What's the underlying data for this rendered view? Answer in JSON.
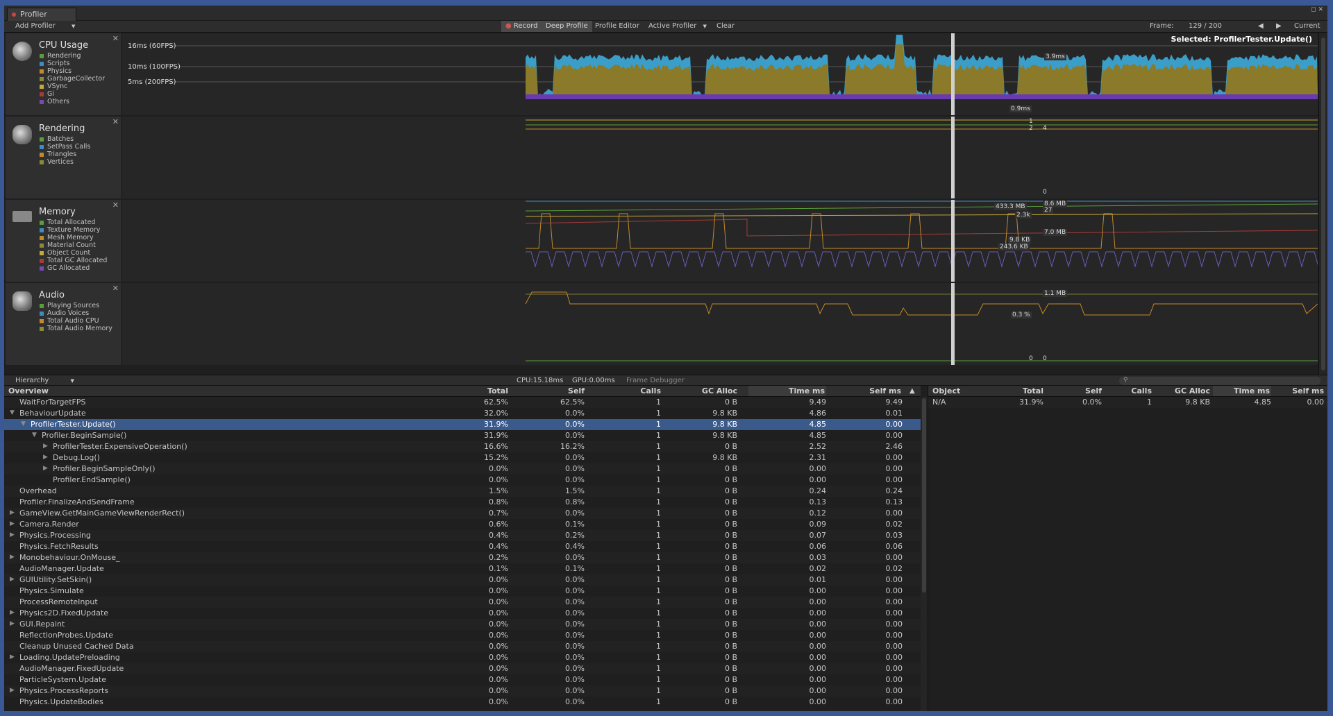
{
  "window": {
    "tab_title": "Profiler"
  },
  "toolbar": {
    "add_profiler": "Add Profiler",
    "record": "Record",
    "deep_profile": "Deep Profile",
    "profile_editor": "Profile Editor",
    "active_profiler": "Active Profiler",
    "clear": "Clear",
    "frame_label": "Frame:",
    "frame_value": "129 / 200",
    "current": "Current"
  },
  "cpu": {
    "title": "CPU Usage",
    "items": [
      {
        "label": "Rendering",
        "color": "#5a9e3a"
      },
      {
        "label": "Scripts",
        "color": "#3a8ec4"
      },
      {
        "label": "Physics",
        "color": "#c48a2a"
      },
      {
        "label": "GarbageCollector",
        "color": "#8a8a3a"
      },
      {
        "label": "VSync",
        "color": "#c4a83a"
      },
      {
        "label": "Gi",
        "color": "#a83a3a"
      },
      {
        "label": "Others",
        "color": "#7a4ab4"
      }
    ],
    "lines": [
      "16ms (60FPS)",
      "10ms (100FPS)",
      "5ms (200FPS)"
    ],
    "selected": "Selected: ProfilerTester.Update()",
    "val1": "3.9ms",
    "val2": "0.9ms"
  },
  "rendering": {
    "title": "Rendering",
    "items": [
      {
        "label": "Batches",
        "color": "#5a9e3a"
      },
      {
        "label": "SetPass Calls",
        "color": "#3a8ec4"
      },
      {
        "label": "Triangles",
        "color": "#c48a2a"
      },
      {
        "label": "Vertices",
        "color": "#8a8a3a"
      }
    ],
    "vals": [
      "1",
      "2",
      "4",
      "0"
    ]
  },
  "memory": {
    "title": "Memory",
    "items": [
      {
        "label": "Total Allocated",
        "color": "#5a9e3a"
      },
      {
        "label": "Texture Memory",
        "color": "#3a8ec4"
      },
      {
        "label": "Mesh Memory",
        "color": "#c48a2a"
      },
      {
        "label": "Material Count",
        "color": "#8a8a3a"
      },
      {
        "label": "Object Count",
        "color": "#c4a83a"
      },
      {
        "label": "Total GC Allocated",
        "color": "#a83a3a"
      },
      {
        "label": "GC Allocated",
        "color": "#7a4ab4"
      }
    ],
    "vals": [
      "433.3 MB",
      "8.6 MB",
      "2.3k",
      "27",
      "7.0 MB",
      "9.8 KB",
      "243.6 KB"
    ]
  },
  "audio": {
    "title": "Audio",
    "items": [
      {
        "label": "Playing Sources",
        "color": "#5a9e3a"
      },
      {
        "label": "Audio Voices",
        "color": "#3a8ec4"
      },
      {
        "label": "Total Audio CPU",
        "color": "#c48a2a"
      },
      {
        "label": "Total Audio Memory",
        "color": "#8a8a3a"
      }
    ],
    "vals": [
      "1.1 MB",
      "0.3 %",
      "0",
      "0"
    ]
  },
  "midbar": {
    "hierarchy": "Hierarchy",
    "cpu": "CPU:15.18ms",
    "gpu": "GPU:0.00ms",
    "frame_debugger": "Frame Debugger"
  },
  "hierarchy": {
    "columns": [
      "Overview",
      "Total",
      "Self",
      "Calls",
      "GC Alloc",
      "Time ms",
      "Self ms"
    ],
    "rows": [
      {
        "name": "WaitForTargetFPS",
        "total": "62.5%",
        "self": "62.5%",
        "calls": "1",
        "gc": "0 B",
        "time": "9.49",
        "selfms": "9.49",
        "indent": 0,
        "exp": ""
      },
      {
        "name": "BehaviourUpdate",
        "total": "32.0%",
        "self": "0.0%",
        "calls": "1",
        "gc": "9.8 KB",
        "time": "4.86",
        "selfms": "0.01",
        "indent": 0,
        "exp": "▼"
      },
      {
        "name": "ProfilerTester.Update()",
        "total": "31.9%",
        "self": "0.0%",
        "calls": "1",
        "gc": "9.8 KB",
        "time": "4.85",
        "selfms": "0.00",
        "indent": 1,
        "exp": "▼",
        "sel": true
      },
      {
        "name": "Profiler.BeginSample()",
        "total": "31.9%",
        "self": "0.0%",
        "calls": "1",
        "gc": "9.8 KB",
        "time": "4.85",
        "selfms": "0.00",
        "indent": 2,
        "exp": "▼"
      },
      {
        "name": "ProfilerTester.ExpensiveOperation()",
        "total": "16.6%",
        "self": "16.2%",
        "calls": "1",
        "gc": "0 B",
        "time": "2.52",
        "selfms": "2.46",
        "indent": 3,
        "exp": "▶"
      },
      {
        "name": "Debug.Log()",
        "total": "15.2%",
        "self": "0.0%",
        "calls": "1",
        "gc": "9.8 KB",
        "time": "2.31",
        "selfms": "0.00",
        "indent": 3,
        "exp": "▶"
      },
      {
        "name": "Profiler.BeginSampleOnly()",
        "total": "0.0%",
        "self": "0.0%",
        "calls": "1",
        "gc": "0 B",
        "time": "0.00",
        "selfms": "0.00",
        "indent": 3,
        "exp": "▶"
      },
      {
        "name": "Profiler.EndSample()",
        "total": "0.0%",
        "self": "0.0%",
        "calls": "1",
        "gc": "0 B",
        "time": "0.00",
        "selfms": "0.00",
        "indent": 3,
        "exp": ""
      },
      {
        "name": "Overhead",
        "total": "1.5%",
        "self": "1.5%",
        "calls": "1",
        "gc": "0 B",
        "time": "0.24",
        "selfms": "0.24",
        "indent": 0,
        "exp": ""
      },
      {
        "name": "Profiler.FinalizeAndSendFrame",
        "total": "0.8%",
        "self": "0.8%",
        "calls": "1",
        "gc": "0 B",
        "time": "0.13",
        "selfms": "0.13",
        "indent": 0,
        "exp": ""
      },
      {
        "name": "GameView.GetMainGameViewRenderRect()",
        "total": "0.7%",
        "self": "0.0%",
        "calls": "1",
        "gc": "0 B",
        "time": "0.12",
        "selfms": "0.00",
        "indent": 0,
        "exp": "▶"
      },
      {
        "name": "Camera.Render",
        "total": "0.6%",
        "self": "0.1%",
        "calls": "1",
        "gc": "0 B",
        "time": "0.09",
        "selfms": "0.02",
        "indent": 0,
        "exp": "▶"
      },
      {
        "name": "Physics.Processing",
        "total": "0.4%",
        "self": "0.2%",
        "calls": "1",
        "gc": "0 B",
        "time": "0.07",
        "selfms": "0.03",
        "indent": 0,
        "exp": "▶"
      },
      {
        "name": "Physics.FetchResults",
        "total": "0.4%",
        "self": "0.4%",
        "calls": "1",
        "gc": "0 B",
        "time": "0.06",
        "selfms": "0.06",
        "indent": 0,
        "exp": ""
      },
      {
        "name": "Monobehaviour.OnMouse_",
        "total": "0.2%",
        "self": "0.0%",
        "calls": "1",
        "gc": "0 B",
        "time": "0.03",
        "selfms": "0.00",
        "indent": 0,
        "exp": "▶"
      },
      {
        "name": "AudioManager.Update",
        "total": "0.1%",
        "self": "0.1%",
        "calls": "1",
        "gc": "0 B",
        "time": "0.02",
        "selfms": "0.02",
        "indent": 0,
        "exp": ""
      },
      {
        "name": "GUIUtility.SetSkin()",
        "total": "0.0%",
        "self": "0.0%",
        "calls": "1",
        "gc": "0 B",
        "time": "0.01",
        "selfms": "0.00",
        "indent": 0,
        "exp": "▶"
      },
      {
        "name": "Physics.Simulate",
        "total": "0.0%",
        "self": "0.0%",
        "calls": "1",
        "gc": "0 B",
        "time": "0.00",
        "selfms": "0.00",
        "indent": 0,
        "exp": ""
      },
      {
        "name": "ProcessRemoteInput",
        "total": "0.0%",
        "self": "0.0%",
        "calls": "1",
        "gc": "0 B",
        "time": "0.00",
        "selfms": "0.00",
        "indent": 0,
        "exp": ""
      },
      {
        "name": "Physics2D.FixedUpdate",
        "total": "0.0%",
        "self": "0.0%",
        "calls": "1",
        "gc": "0 B",
        "time": "0.00",
        "selfms": "0.00",
        "indent": 0,
        "exp": "▶"
      },
      {
        "name": "GUI.Repaint",
        "total": "0.0%",
        "self": "0.0%",
        "calls": "1",
        "gc": "0 B",
        "time": "0.00",
        "selfms": "0.00",
        "indent": 0,
        "exp": "▶"
      },
      {
        "name": "ReflectionProbes.Update",
        "total": "0.0%",
        "self": "0.0%",
        "calls": "1",
        "gc": "0 B",
        "time": "0.00",
        "selfms": "0.00",
        "indent": 0,
        "exp": ""
      },
      {
        "name": "Cleanup Unused Cached Data",
        "total": "0.0%",
        "self": "0.0%",
        "calls": "1",
        "gc": "0 B",
        "time": "0.00",
        "selfms": "0.00",
        "indent": 0,
        "exp": ""
      },
      {
        "name": "Loading.UpdatePreloading",
        "total": "0.0%",
        "self": "0.0%",
        "calls": "1",
        "gc": "0 B",
        "time": "0.00",
        "selfms": "0.00",
        "indent": 0,
        "exp": "▶"
      },
      {
        "name": "AudioManager.FixedUpdate",
        "total": "0.0%",
        "self": "0.0%",
        "calls": "1",
        "gc": "0 B",
        "time": "0.00",
        "selfms": "0.00",
        "indent": 0,
        "exp": ""
      },
      {
        "name": "ParticleSystem.Update",
        "total": "0.0%",
        "self": "0.0%",
        "calls": "1",
        "gc": "0 B",
        "time": "0.00",
        "selfms": "0.00",
        "indent": 0,
        "exp": ""
      },
      {
        "name": "Physics.ProcessReports",
        "total": "0.0%",
        "self": "0.0%",
        "calls": "1",
        "gc": "0 B",
        "time": "0.00",
        "selfms": "0.00",
        "indent": 0,
        "exp": "▶"
      },
      {
        "name": "Physics.UpdateBodies",
        "total": "0.0%",
        "self": "0.0%",
        "calls": "1",
        "gc": "0 B",
        "time": "0.00",
        "selfms": "0.00",
        "indent": 0,
        "exp": ""
      }
    ]
  },
  "detail": {
    "columns": [
      "Object",
      "Total",
      "Self",
      "Calls",
      "GC Alloc",
      "Time ms",
      "Self ms"
    ],
    "rows": [
      {
        "object": "N/A",
        "total": "31.9%",
        "self": "0.0%",
        "calls": "1",
        "gc": "9.8 KB",
        "time": "4.85",
        "selfms": "0.00"
      }
    ]
  }
}
